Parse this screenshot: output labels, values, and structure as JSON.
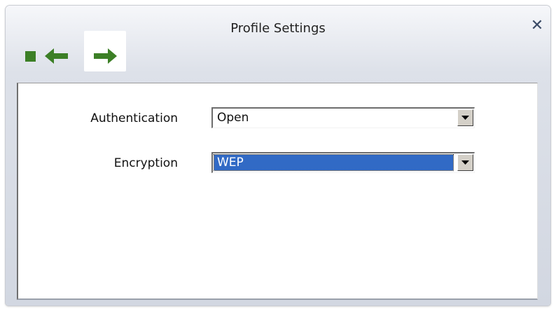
{
  "window": {
    "title": "Profile Settings"
  },
  "toolbar": {
    "buttons": [
      {
        "name": "stop",
        "icon": "stop-icon"
      },
      {
        "name": "back",
        "icon": "arrow-left-icon"
      },
      {
        "name": "next",
        "icon": "arrow-right-icon",
        "highlighted": true
      }
    ],
    "icon_color": "#3c7f26"
  },
  "form": {
    "authentication": {
      "label": "Authentication",
      "value": "Open"
    },
    "encryption": {
      "label": "Encryption",
      "value": "WEP"
    }
  },
  "colors": {
    "selection": "#316ac5"
  }
}
